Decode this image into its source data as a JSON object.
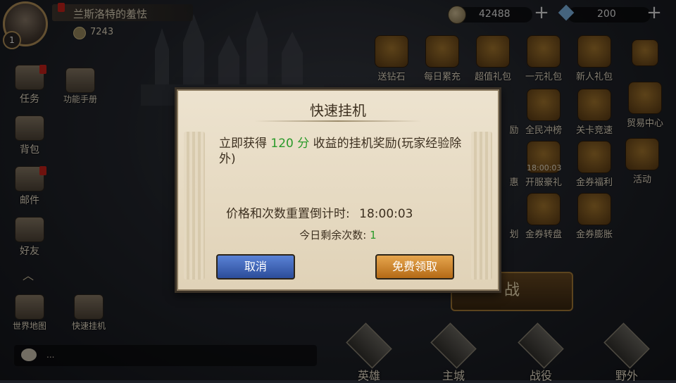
{
  "player": {
    "name": "兰斯洛特的羞怯",
    "level": "1",
    "power": "7243"
  },
  "resources": {
    "coins": "42488",
    "gems": "200"
  },
  "left_menu": [
    {
      "label": "任务"
    },
    {
      "label": "功能手册"
    },
    {
      "label": "背包"
    },
    {
      "label": "邮件"
    },
    {
      "label": "好友"
    },
    {
      "label": "世界地图"
    },
    {
      "label": "快速挂机"
    }
  ],
  "right_menu": [
    {
      "label": "送钻石"
    },
    {
      "label": "每日累充"
    },
    {
      "label": "超值礼包"
    },
    {
      "label": "一元礼包"
    },
    {
      "label": "新人礼包"
    },
    {
      "label": "励"
    },
    {
      "label": "全民冲榜"
    },
    {
      "label": "关卡竞速"
    },
    {
      "label": "贸易中心"
    },
    {
      "label": "惠"
    },
    {
      "label": "开服豪礼"
    },
    {
      "label": "金券福利"
    },
    {
      "label": "活动"
    },
    {
      "label": "划"
    },
    {
      "label": "金券转盘"
    },
    {
      "label": "金券膨胀"
    }
  ],
  "timer_overlay": "18:00:03",
  "battle_button": "战",
  "chat": {
    "placeholder": "..."
  },
  "bottom_nav": [
    {
      "label": "英雄"
    },
    {
      "label": "主城"
    },
    {
      "label": "战役"
    },
    {
      "label": "野外"
    }
  ],
  "dialog": {
    "title": "快速挂机",
    "reward_prefix": "立即获得",
    "reward_amount": "120 分",
    "reward_suffix": "收益的挂机奖励(玩家经验除外)",
    "timer_label": "价格和次数重置倒计时:",
    "timer_value": "18:00:03",
    "remaining_label": "今日剩余次数:",
    "remaining_value": "1",
    "cancel_label": "取消",
    "claim_label": "免费领取"
  },
  "colors": {
    "accent_green": "#2a9a2a",
    "cancel_button": "#3a62b8",
    "claim_button": "#d08a2e",
    "dialog_bg": "#e6dac2"
  }
}
